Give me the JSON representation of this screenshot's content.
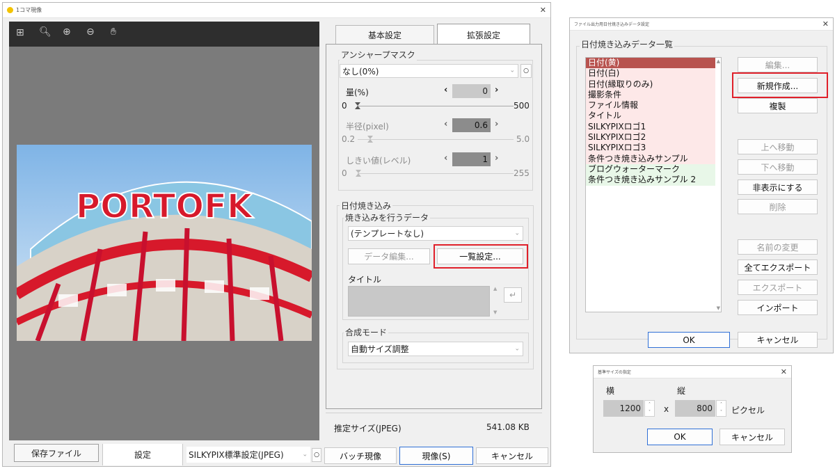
{
  "main_window": {
    "title": "1コマ現像",
    "tabs": [
      "基本設定",
      "拡張設定"
    ],
    "unsharp": {
      "group_label": "アンシャープマスク",
      "preset": "なし(0%)",
      "amount": {
        "label": "量(%)",
        "value": "0",
        "min": "0",
        "max": "500",
        "level": 0
      },
      "radius": {
        "label": "半径(pixel)",
        "value": "0.6",
        "min": "0.2",
        "max": "5.0",
        "level": 0.08
      },
      "threshold": {
        "label": "しきい値(レベル)",
        "value": "1",
        "min": "0",
        "max": "255",
        "level": 0.004
      }
    },
    "date_imprint": {
      "group_label": "日付焼き込み",
      "data_label": "焼き込みを行うデータ",
      "template": "(テンプレートなし)",
      "edit_button": "データ編集...",
      "list_button": "一覧設定...",
      "title_label": "タイトル",
      "compose_label": "合成モード",
      "compose_value": "自動サイズ調整"
    },
    "estimate": {
      "label": "推定サイズ(JPEG)",
      "value": "541.08 KB"
    },
    "bottom": {
      "save_tab": "保存ファイル",
      "settings_tab": "設定",
      "preset": "SILKYPIX標準設定(JPEG)",
      "batch": "バッチ現像",
      "develop": "現像(S)",
      "cancel": "キャンセル"
    },
    "photo_sign": "PORTOFK"
  },
  "imprint_dialog": {
    "title": "ファイル出力用日付焼き込みデータ設定",
    "group_label": "日付焼き込みデータ一覧",
    "items": [
      {
        "label": "日付(黄)",
        "bg": "#b8534f",
        "fg": "#ffffff"
      },
      {
        "label": "日付(白)",
        "bg": "#fde8e8",
        "fg": "#111111"
      },
      {
        "label": "日付(縁取りのみ)",
        "bg": "#fde8e8",
        "fg": "#111111"
      },
      {
        "label": "撮影条件",
        "bg": "#fde8e8",
        "fg": "#111111"
      },
      {
        "label": "ファイル情報",
        "bg": "#fde8e8",
        "fg": "#111111"
      },
      {
        "label": "タイトル",
        "bg": "#fde8e8",
        "fg": "#111111"
      },
      {
        "label": "SILKYPIXロゴ1",
        "bg": "#fde8e8",
        "fg": "#111111"
      },
      {
        "label": "SILKYPIXロゴ2",
        "bg": "#fde8e8",
        "fg": "#111111"
      },
      {
        "label": "SILKYPIXロゴ3",
        "bg": "#fde8e8",
        "fg": "#111111"
      },
      {
        "label": "条件つき焼き込みサンプル",
        "bg": "#fde8e8",
        "fg": "#111111"
      },
      {
        "label": "ブログウォーターマーク",
        "bg": "#e8f7e8",
        "fg": "#111111"
      },
      {
        "label": "条件つき焼き込みサンプル 2",
        "bg": "#e8f7e8",
        "fg": "#111111"
      }
    ],
    "buttons": {
      "edit": "編集...",
      "new": "新規作成...",
      "duplicate": "複製",
      "move_up": "上へ移動",
      "move_down": "下へ移動",
      "hide": "非表示にする",
      "delete": "削除",
      "rename": "名前の変更",
      "export_all": "全てエクスポート",
      "export": "エクスポート",
      "import": "インポート",
      "ok": "OK",
      "cancel": "キャンセル"
    }
  },
  "size_dialog": {
    "title": "基準サイズの指定",
    "width_label": "横",
    "height_label": "縦",
    "width_value": "1200",
    "height_value": "800",
    "times": "x",
    "unit": "ピクセル",
    "ok": "OK",
    "cancel": "キャンセル"
  },
  "colors": {
    "highlight_red": "#e0202a",
    "list_selected": "#b8534f",
    "list_pink": "#fde8e8",
    "list_green": "#e8f7e8"
  }
}
